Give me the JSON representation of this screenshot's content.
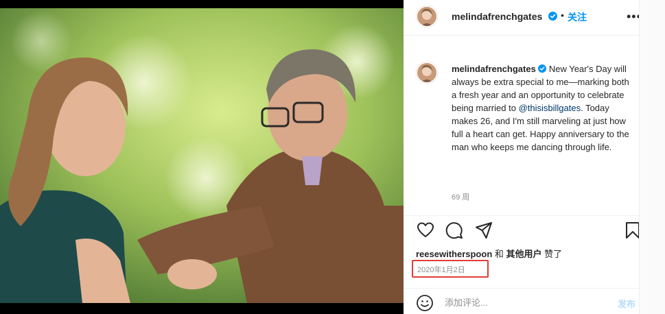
{
  "post": {
    "username": "melindafrenchgates",
    "follow_separator": "•",
    "follow_label": "关注",
    "more_label": "•••"
  },
  "caption": {
    "username": "melindafrenchgates",
    "text_before_mention": "New Year's Day will always be extra special to me—marking both a fresh year and an opportunity to celebrate being married to ",
    "mention": "@thisisbillgates",
    "text_after_mention": ". Today makes 26, and I'm still marveling at just how full a heart can get. Happy anniversary to the man who keeps me dancing through life.",
    "time_ago": "69 周"
  },
  "likes": {
    "user": "reesewitherspoon",
    "connector": " 和 ",
    "others": "其他用户",
    "suffix": " 赞了"
  },
  "date": "2020年1月2日",
  "comment_bar": {
    "placeholder": "添加评论...",
    "post_label": "发布"
  },
  "icons": [
    "verified-badge-icon",
    "heart-icon",
    "comment-icon",
    "share-icon",
    "bookmark-icon",
    "emoji-icon",
    "more-options-icon"
  ],
  "colors": {
    "accent_blue": "#0095f6",
    "post_button_disabled": "#b2dffc",
    "mention": "#00376b",
    "highlight_box": "#e23b34",
    "secondary_text": "#8e8e8e"
  }
}
